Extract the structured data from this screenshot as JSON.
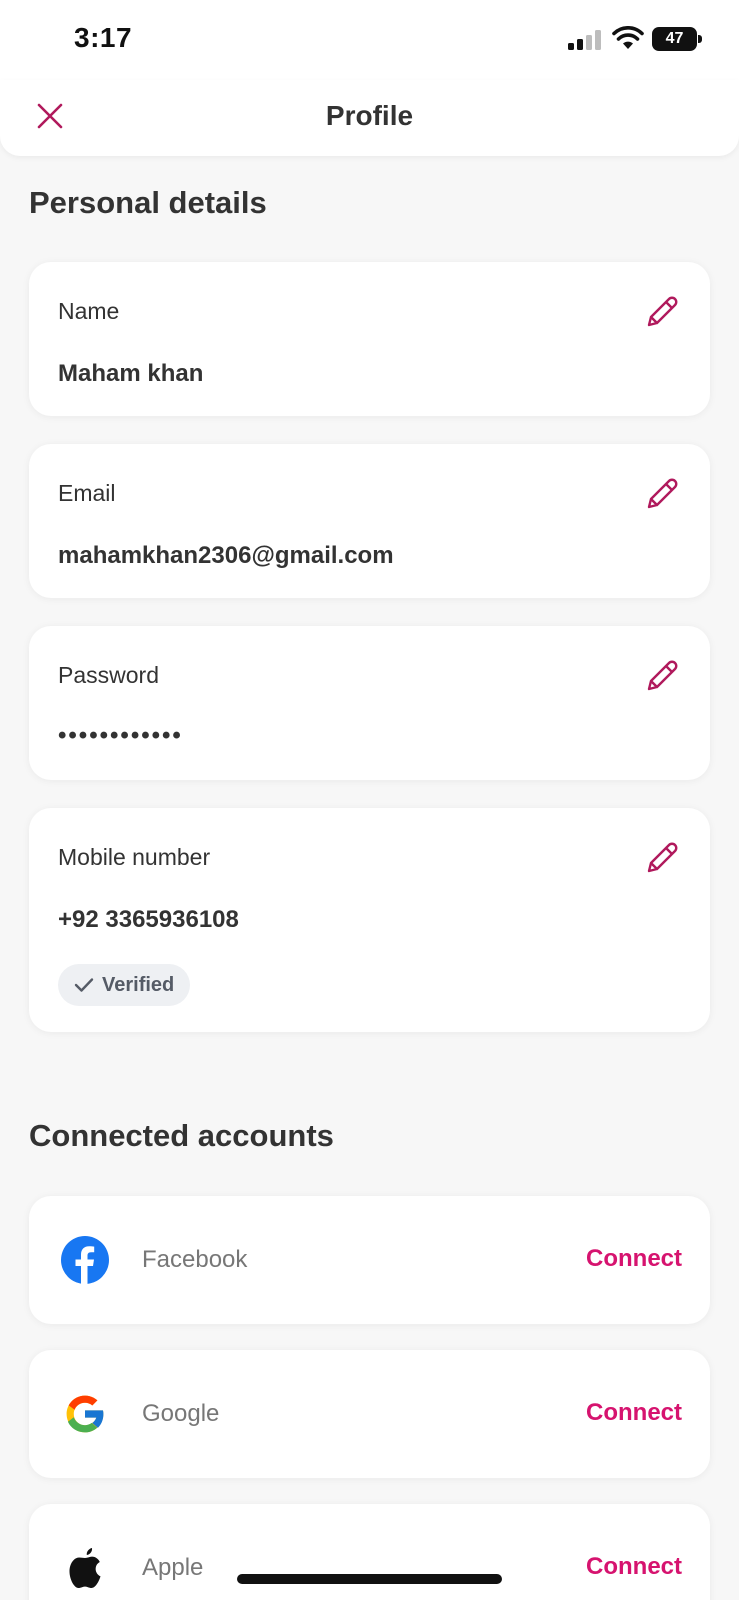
{
  "status_bar": {
    "time": "3:17",
    "battery_level": "47",
    "icons": [
      "cellular-signal-icon",
      "wifi-icon",
      "battery-icon"
    ]
  },
  "header": {
    "title": "Profile",
    "close_icon": "close-icon"
  },
  "personal_details": {
    "title": "Personal details",
    "fields": [
      {
        "label": "Name",
        "value": "Maham khan"
      },
      {
        "label": "Email",
        "value": "mahamkhan2306@gmail.com"
      },
      {
        "label": "Password",
        "value": "••••••••••••"
      },
      {
        "label": "Mobile number",
        "value": "+92 3365936108",
        "badge": "Verified"
      }
    ],
    "edit_icon": "pencil-icon"
  },
  "connected_accounts": {
    "title": "Connected accounts",
    "items": [
      {
        "name": "Facebook",
        "action": "Connect",
        "icon": "facebook-icon"
      },
      {
        "name": "Google",
        "action": "Connect",
        "icon": "google-icon"
      },
      {
        "name": "Apple",
        "action": "Connect",
        "icon": "apple-icon"
      }
    ]
  },
  "colors": {
    "accent": "#d6136f",
    "edit_icon": "#b0195c",
    "text": "#333333",
    "background": "#f7f7f7",
    "card": "#ffffff",
    "facebook_blue": "#1877f2"
  }
}
